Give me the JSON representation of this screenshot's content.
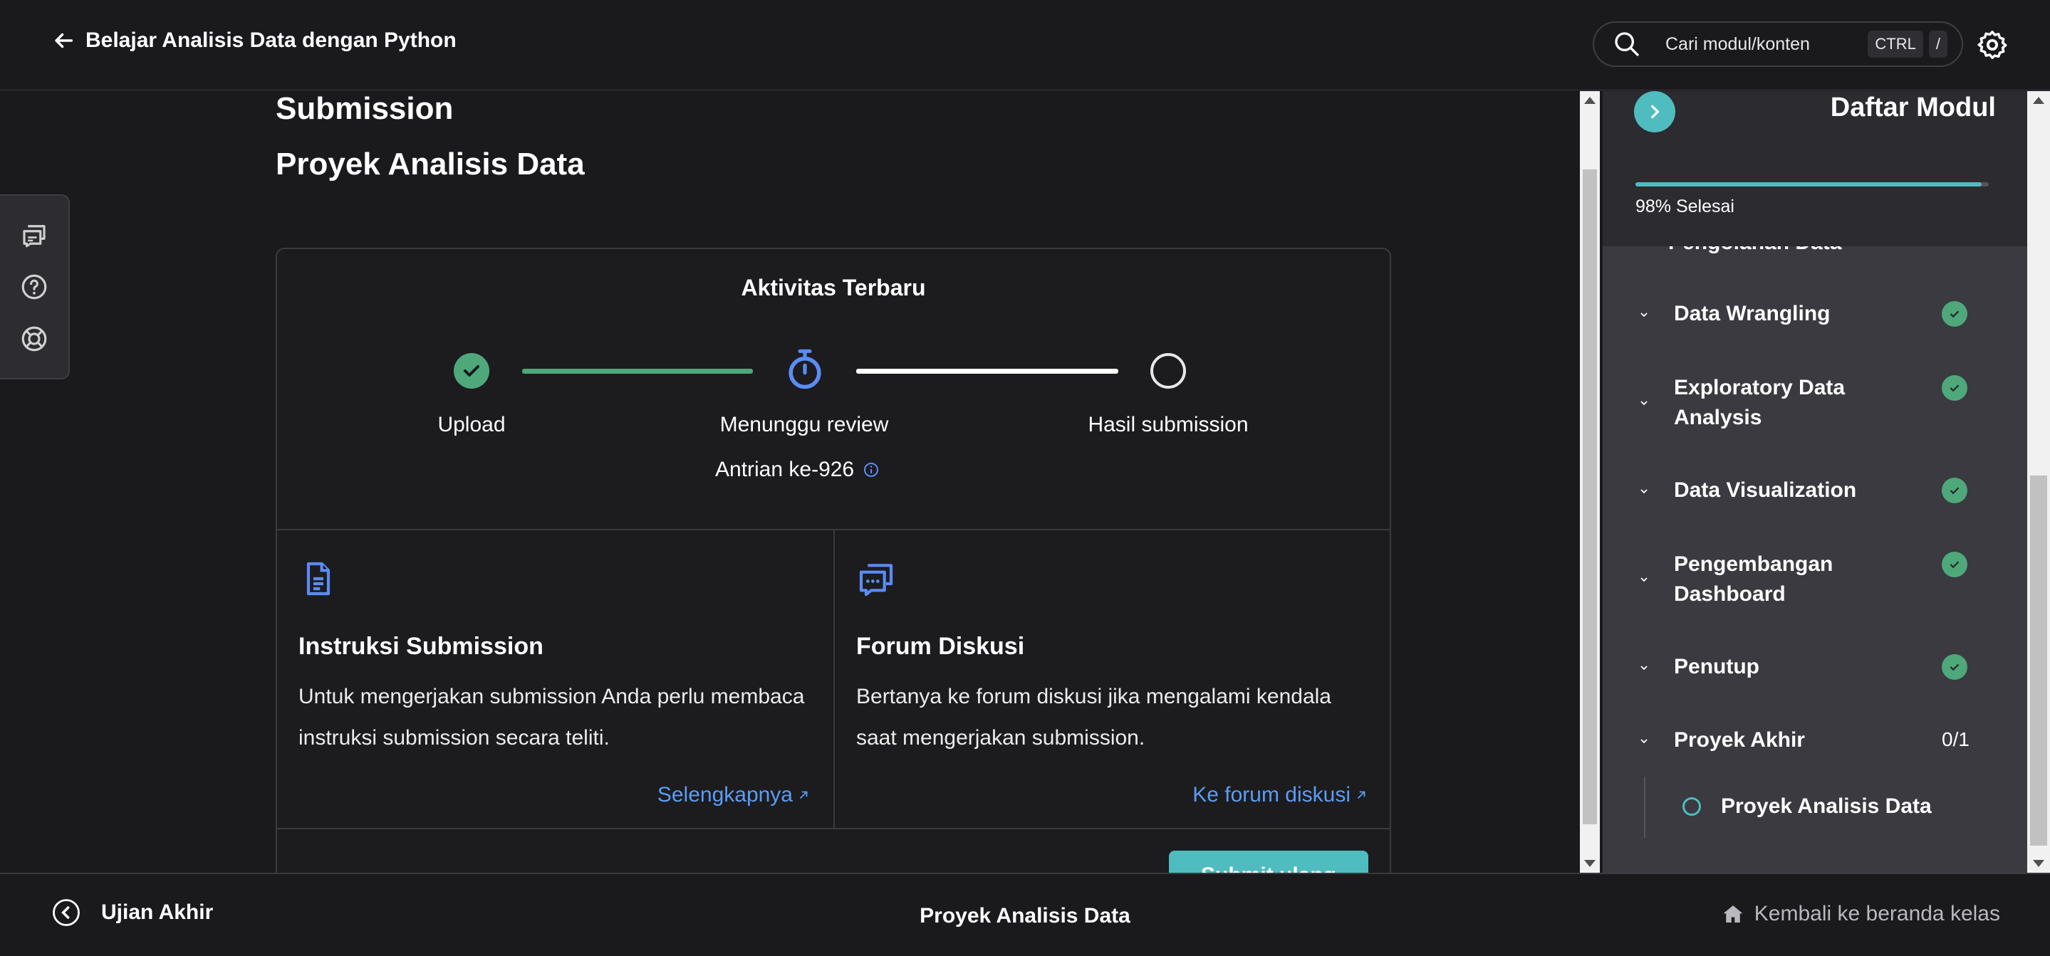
{
  "header": {
    "course_title": "Belajar Analisis Data dengan Python",
    "search_placeholder": "Cari modul/konten",
    "shortcut_key1": "CTRL",
    "shortcut_key2": "/"
  },
  "main": {
    "section_heading": "Submission",
    "page_title": "Proyek Analisis Data",
    "activity": {
      "title": "Aktivitas Terbaru",
      "steps": [
        {
          "label": "Upload",
          "state": "done"
        },
        {
          "label": "Menunggu review",
          "state": "active"
        },
        {
          "label": "Hasil submission",
          "state": "pending"
        }
      ],
      "queue_text": "Antrian ke-926"
    },
    "instructions": {
      "title": "Instruksi Submission",
      "text": "Untuk mengerjakan submission Anda perlu membaca instruksi submission secara teliti.",
      "link": "Selengkapnya"
    },
    "forum": {
      "title": "Forum Diskusi",
      "text": "Bertanya ke forum diskusi jika mengalami kendala saat mengerjakan submission.",
      "link": "Ke forum diskusi"
    },
    "resubmit_label": "Submit ulang"
  },
  "sidebar": {
    "title": "Daftar Modul",
    "progress_text": "98% Selesai",
    "progress_value": 0.98,
    "partial_item": "Pengolahan Data",
    "modules": [
      {
        "label": "Data Wrangling",
        "status": "done"
      },
      {
        "label": "Exploratory Data Analysis",
        "status": "done"
      },
      {
        "label": "Data Visualization",
        "status": "done"
      },
      {
        "label": "Pengembangan Dashboard",
        "status": "done"
      },
      {
        "label": "Penutup",
        "status": "done"
      },
      {
        "label": "Proyek Akhir",
        "status": "count",
        "count": "0/1"
      }
    ],
    "active_sub_item": "Proyek Analisis Data"
  },
  "footer": {
    "prev_label": "Ujian Akhir",
    "current_label": "Proyek Analisis Data",
    "home_label": "Kembali ke beranda kelas"
  },
  "colors": {
    "accent": "#4fbcbf",
    "success": "#4ea87a",
    "link": "#5b9cf5",
    "background": "#1a1a1d"
  }
}
